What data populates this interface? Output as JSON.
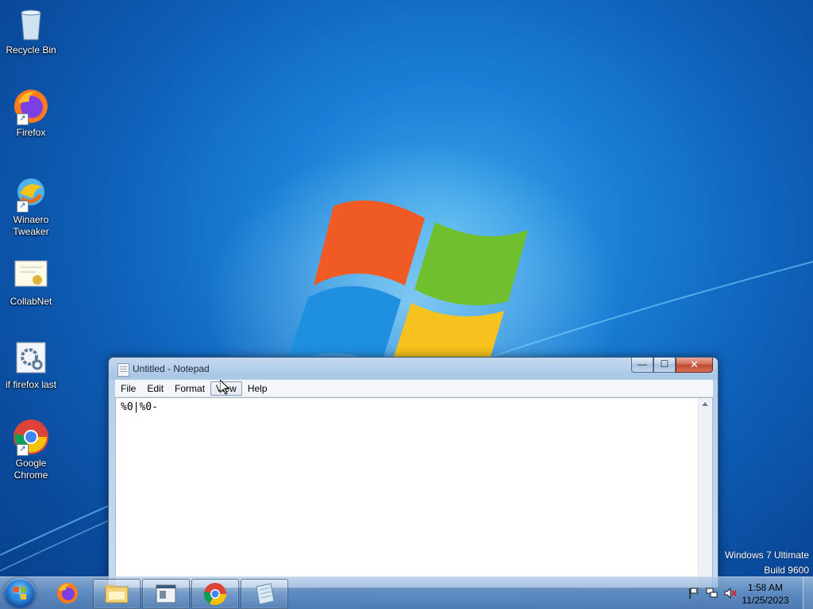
{
  "desktop": {
    "icons": [
      {
        "label": "Recycle Bin"
      },
      {
        "label": "Firefox"
      },
      {
        "label": "Winaero\nTweaker"
      },
      {
        "label": "CollabNet"
      },
      {
        "label": "if firefox last"
      },
      {
        "label": "Google\nChrome"
      }
    ],
    "watermark_line1": "Windows 7 Ultimate",
    "watermark_line2": "Build 9600"
  },
  "notepad": {
    "title": "Untitled - Notepad",
    "menu": [
      "File",
      "Edit",
      "Format",
      "View",
      "Help"
    ],
    "active_menu": "View",
    "content": "%0|%0-",
    "buttons": {
      "minimize": "—",
      "maximize": "☐",
      "close": "✕"
    }
  },
  "taskbar": {
    "items": [
      "start",
      "firefox-icon",
      "windows-explorer-icon",
      "winaero-tweaker-icon",
      "google-chrome-icon",
      "notepad-icon"
    ],
    "clock_time": "1:58 AM",
    "clock_date": "11/25/2023"
  },
  "colors": {
    "desktop_blue": "#0e5fb8",
    "close_red": "#c24a32"
  }
}
